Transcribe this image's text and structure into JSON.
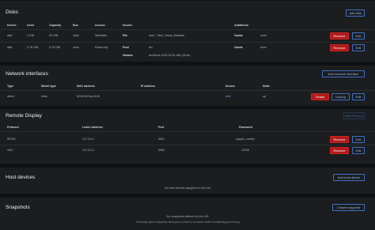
{
  "disks": {
    "title": "Disks",
    "add_button": "Add disk",
    "columns": [
      "Device",
      "Used",
      "Capacity",
      "Bus",
      "Access",
      "Source",
      "",
      "Additional",
      ""
    ],
    "rows": [
      {
        "device": "disk",
        "used": "0 GiB",
        "capacity": "20 GiB",
        "bus": "virtio",
        "access": "Writeable",
        "src1_label": "File",
        "src1_value": "/ant/.../Test_Virtual_Machine",
        "add_label": "Cache",
        "add_value": "none",
        "remove": "Remove",
        "edit": "Edit"
      },
      {
        "device": "disk",
        "used": "0.78 GiB",
        "capacity": "0.78 GiB",
        "bus": "virtio",
        "access": "Read-only",
        "src1_label": "Pool",
        "src1_value": "iso",
        "src2_label": "Volume",
        "src2_value": "archlinux-2022.02.01-x86_64.iso",
        "add_label": "Cache",
        "add_value": "none",
        "remove": "Remove",
        "edit": "Edit"
      }
    ]
  },
  "network": {
    "title": "Network interfaces",
    "add_button": "Add network interface",
    "columns": [
      "Type",
      "Model type",
      "MAC address",
      "IP address",
      "Source",
      "State"
    ],
    "rows": [
      {
        "type": "direct",
        "model": "virtio",
        "mac": "52:54:00:0a:43:2b",
        "ip": "",
        "source": "eth0",
        "state": "up",
        "delete": "Delete",
        "unplug": "Unplug",
        "edit": "Edit"
      }
    ]
  },
  "display": {
    "title": "Remote Display",
    "add_button": "Add Protocol",
    "columns": [
      "Protocol",
      "Listen Address",
      "Port",
      "Password"
    ],
    "rows": [
      {
        "protocol": "SPICE",
        "address": "127.0.0.1",
        "port": "5901",
        "password": "supper_combo",
        "remove": "Remove",
        "edit": "Edit"
      },
      {
        "protocol": "VNC",
        "address": "127.0.0.1",
        "port": "5900",
        "password": "12345",
        "remove": "Remove",
        "edit": "Edit"
      }
    ]
  },
  "host_devices": {
    "title": "Host devices",
    "add_button": "Add host device",
    "empty": "No host devices assigned to this VM"
  },
  "snapshots": {
    "title": "Snapshots",
    "add_button": "Create snapshot",
    "empty": "No snapshots defined for this VM",
    "empty_hint": "Previously taken snapshots allow you to revert to an earlier state if something goes wrong"
  }
}
